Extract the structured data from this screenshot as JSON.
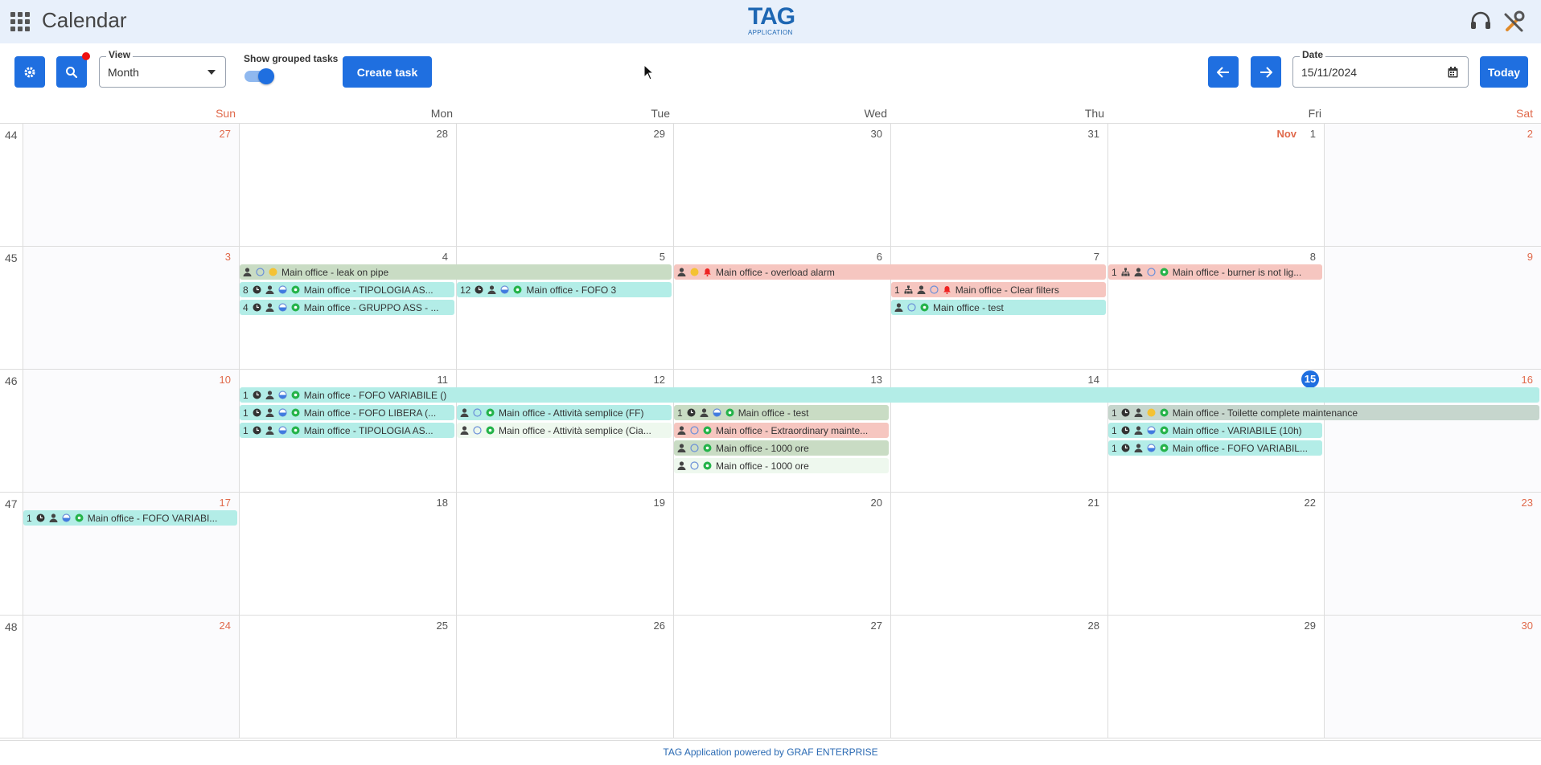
{
  "app": {
    "title": "Calendar",
    "logo_main": "TAG",
    "logo_sub": "APPLICATION",
    "footer": "TAG Application powered by GRAF ENTERPRISE"
  },
  "toolbar": {
    "view_label": "View",
    "view_value": "Month",
    "switch_label": "Show grouped tasks",
    "switch_on": true,
    "create_label": "Create task",
    "date_label": "Date",
    "date_value": "15/11/2024",
    "today_label": "Today"
  },
  "weekdays": [
    "Sun",
    "Mon",
    "Tue",
    "Wed",
    "Thu",
    "Fri",
    "Sat"
  ],
  "weeks": [
    {
      "num": "44",
      "days": [
        "27",
        "28",
        "29",
        "30",
        "31",
        "1",
        "2"
      ],
      "month_marker": "Nov"
    },
    {
      "num": "45",
      "days": [
        "3",
        "4",
        "5",
        "6",
        "7",
        "8",
        "9"
      ]
    },
    {
      "num": "46",
      "days": [
        "10",
        "11",
        "12",
        "13",
        "14",
        "15",
        "16"
      ],
      "today": "15"
    },
    {
      "num": "47",
      "days": [
        "17",
        "18",
        "19",
        "20",
        "21",
        "22",
        "23"
      ]
    },
    {
      "num": "48",
      "days": [
        "24",
        "25",
        "26",
        "27",
        "28",
        "29",
        "30"
      ]
    }
  ],
  "events": [
    {
      "week": 1,
      "row": 0,
      "day": 1,
      "span": 2,
      "color": "sage",
      "count": "",
      "icons": [
        "person",
        "circle-empty",
        "dot-yellow"
      ],
      "text": "Main office - leak on pipe"
    },
    {
      "week": 1,
      "row": 0,
      "day": 3,
      "span": 2,
      "color": "red",
      "count": "",
      "icons": [
        "person",
        "dot-yellow",
        "bell-red"
      ],
      "text": "Main office - overload alarm"
    },
    {
      "week": 1,
      "row": 0,
      "day": 5,
      "span": 1,
      "color": "red",
      "count": "1",
      "icons": [
        "hierarchy",
        "person",
        "circle-empty",
        "dot-green"
      ],
      "text": "Main office - burner is not lig..."
    },
    {
      "week": 1,
      "row": 1,
      "day": 1,
      "span": 1,
      "color": "teal",
      "count": "8",
      "icons": [
        "clock",
        "person",
        "half-circle",
        "dot-green"
      ],
      "text": "Main office - TIPOLOGIA AS..."
    },
    {
      "week": 1,
      "row": 1,
      "day": 2,
      "span": 1,
      "color": "teal",
      "count": "12",
      "icons": [
        "clock",
        "person",
        "half-circle",
        "dot-green"
      ],
      "text": "Main office - FOFO 3"
    },
    {
      "week": 1,
      "row": 1,
      "day": 4,
      "span": 1,
      "color": "red",
      "count": "1",
      "icons": [
        "hierarchy",
        "person",
        "circle-empty",
        "bell-red"
      ],
      "text": "Main office - Clear filters"
    },
    {
      "week": 1,
      "row": 2,
      "day": 1,
      "span": 1,
      "color": "teal",
      "count": "4",
      "icons": [
        "clock",
        "person",
        "half-circle",
        "dot-green"
      ],
      "text": "Main office - GRUPPO ASS - ..."
    },
    {
      "week": 1,
      "row": 2,
      "day": 4,
      "span": 1,
      "color": "teal",
      "count": "",
      "icons": [
        "person",
        "circle-empty",
        "dot-green"
      ],
      "text": "Main office - test"
    },
    {
      "week": 2,
      "row": 0,
      "day": 1,
      "span": 6,
      "color": "teal",
      "count": "1",
      "icons": [
        "clock",
        "person",
        "half-circle",
        "dot-green"
      ],
      "text": "Main office - FOFO VARIABILE ()"
    },
    {
      "week": 2,
      "row": 1,
      "day": 1,
      "span": 1,
      "color": "teal",
      "count": "1",
      "icons": [
        "clock",
        "person",
        "half-circle",
        "dot-green"
      ],
      "text": "Main office - FOFO LIBERA (..."
    },
    {
      "week": 2,
      "row": 1,
      "day": 2,
      "span": 1,
      "color": "teal",
      "count": "",
      "icons": [
        "person",
        "circle-empty",
        "dot-green"
      ],
      "text": "Main office - Attività semplice (FF)"
    },
    {
      "week": 2,
      "row": 1,
      "day": 3,
      "span": 1,
      "color": "sage",
      "count": "1",
      "icons": [
        "clock",
        "person",
        "half-circle",
        "dot-green"
      ],
      "text": "Main office - test"
    },
    {
      "week": 2,
      "row": 1,
      "day": 5,
      "span": 2,
      "color": "gray",
      "count": "1",
      "icons": [
        "clock",
        "person",
        "dot-yellow",
        "dot-green"
      ],
      "text": "Main office - Toilette complete maintenance"
    },
    {
      "week": 2,
      "row": 2,
      "day": 1,
      "span": 1,
      "color": "teal",
      "count": "1",
      "icons": [
        "clock",
        "person",
        "half-circle",
        "dot-green"
      ],
      "text": "Main office - TIPOLOGIA AS..."
    },
    {
      "week": 2,
      "row": 2,
      "day": 2,
      "span": 1,
      "color": "pale",
      "count": "",
      "icons": [
        "person",
        "circle-empty",
        "dot-green"
      ],
      "text": "Main office - Attività semplice (Cia..."
    },
    {
      "week": 2,
      "row": 2,
      "day": 3,
      "span": 1,
      "color": "red",
      "count": "",
      "icons": [
        "person",
        "circle-empty",
        "dot-green"
      ],
      "text": "Main office - Extraordinary mainte..."
    },
    {
      "week": 2,
      "row": 2,
      "day": 5,
      "span": 1,
      "color": "teal",
      "count": "1",
      "icons": [
        "clock",
        "person",
        "half-circle",
        "dot-green"
      ],
      "text": "Main office - VARIABILE (10h)"
    },
    {
      "week": 2,
      "row": 3,
      "day": 3,
      "span": 1,
      "color": "sage",
      "count": "",
      "icons": [
        "person",
        "circle-empty",
        "dot-green"
      ],
      "text": "Main office - 1000 ore"
    },
    {
      "week": 2,
      "row": 3,
      "day": 5,
      "span": 1,
      "color": "teal",
      "count": "1",
      "icons": [
        "clock",
        "person",
        "half-circle",
        "dot-green"
      ],
      "text": "Main office - FOFO VARIABIL..."
    },
    {
      "week": 2,
      "row": 4,
      "day": 3,
      "span": 1,
      "color": "pale",
      "count": "",
      "icons": [
        "person",
        "circle-empty",
        "dot-green"
      ],
      "text": "Main office - 1000 ore"
    },
    {
      "week": 3,
      "row": 0,
      "day": 0,
      "span": 1,
      "color": "teal",
      "count": "1",
      "icons": [
        "clock",
        "person",
        "half-circle",
        "dot-green"
      ],
      "text": "Main office - FOFO VARIABI..."
    }
  ]
}
